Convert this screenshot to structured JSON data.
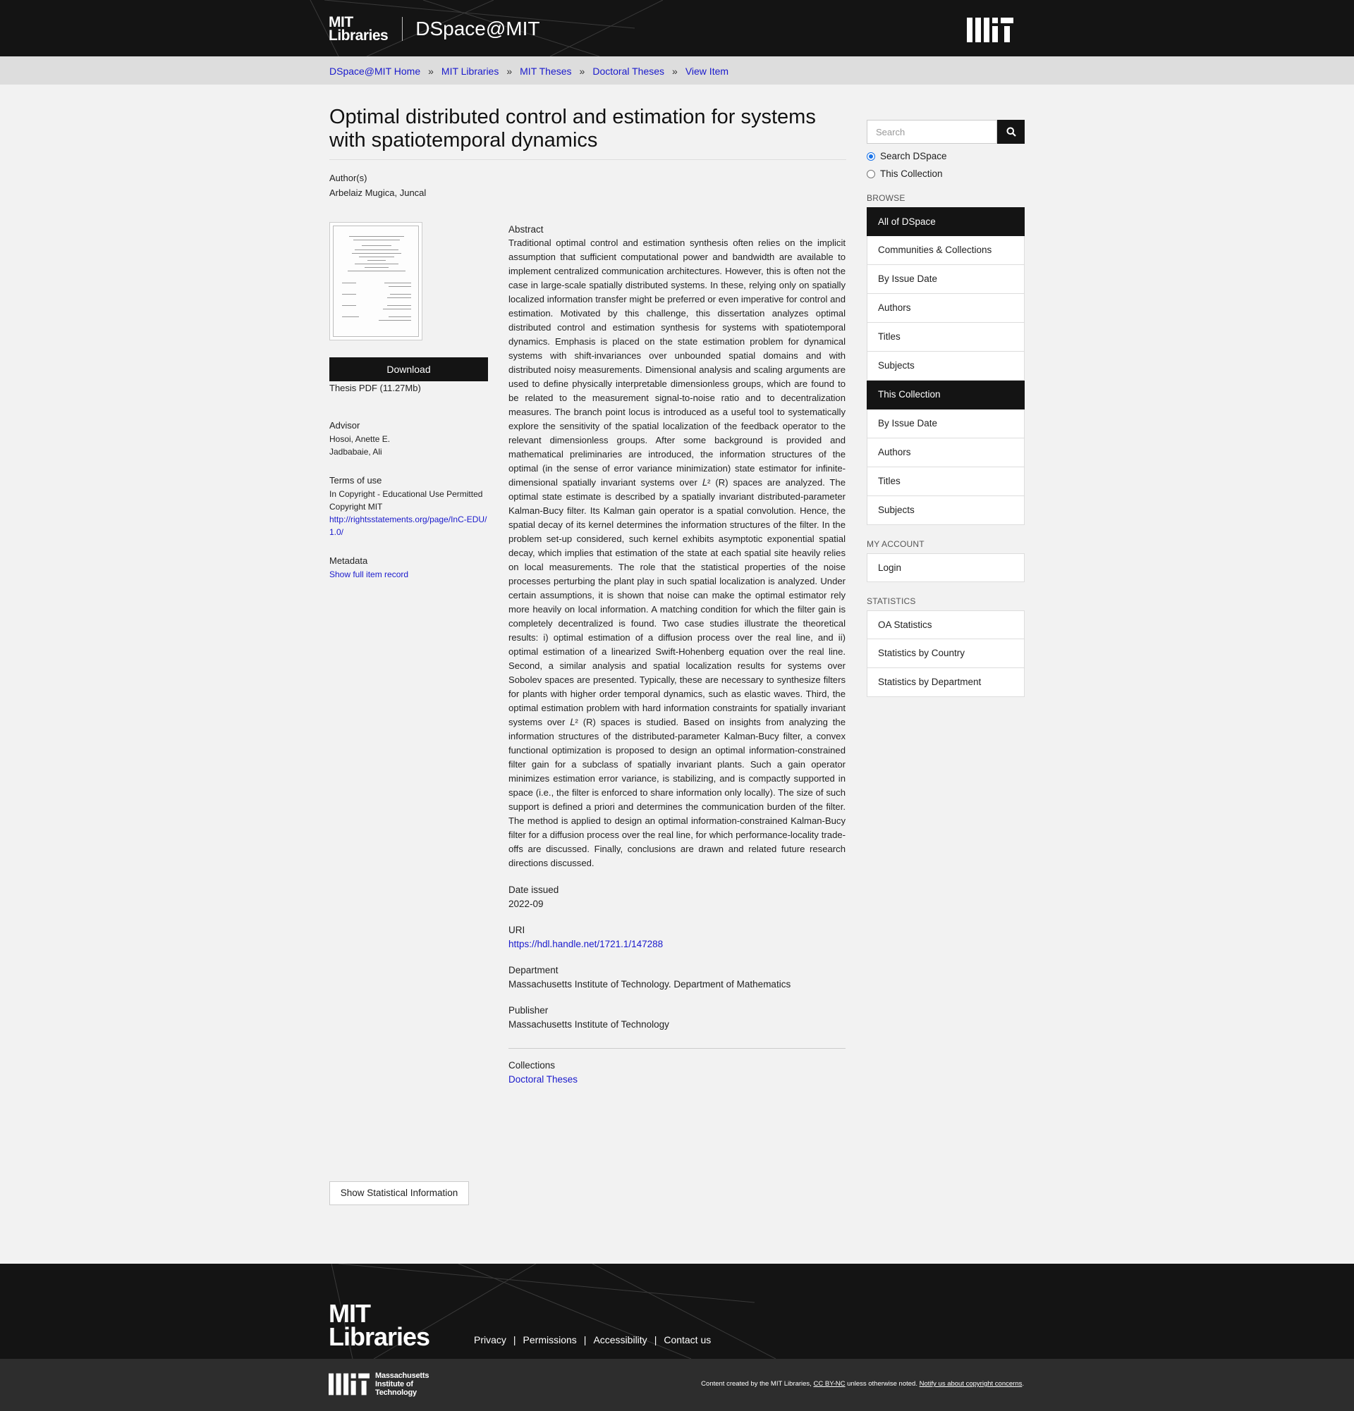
{
  "header": {
    "logo_line1": "MIT",
    "logo_line2": "Libraries",
    "site_name": "DSpace@MIT"
  },
  "breadcrumb": [
    "DSpace@MIT Home",
    "MIT Libraries",
    "MIT Theses",
    "Doctoral Theses",
    "View Item"
  ],
  "breadcrumb_sep": "»",
  "item": {
    "title": "Optimal distributed control and estimation for systems with spatiotemporal dynamics",
    "authors_label": "Author(s)",
    "authors_value": "Arbelaiz Mugica, Juncal",
    "download_label": "Download",
    "file_info": "Thesis PDF (11.27Mb)",
    "advisor_label": "Advisor",
    "advisors": [
      "Hosoi, Anette E.",
      "Jadbabaie, Ali"
    ],
    "terms_label": "Terms of use",
    "terms_text": "In Copyright - Educational Use Permitted Copyright MIT",
    "terms_link": "http://rightsstatements.org/page/InC-EDU/1.0/",
    "metadata_label": "Metadata",
    "metadata_link": "Show full item record",
    "abstract_label": "Abstract",
    "abstract_text": "Traditional optimal control and estimation synthesis often relies on the implicit assumption that sufficient computational power and bandwidth are available to implement centralized communication architectures. However, this is often not the case in large-scale spatially distributed systems. In these, relying only on spatially localized information transfer might be preferred or even imperative for control and estimation. Motivated by this challenge, this dissertation analyzes optimal distributed control and estimation synthesis for systems with spatiotemporal dynamics. Emphasis is placed on the state estimation problem for dynamical systems with shift-invariances over unbounded spatial domains and with distributed noisy measurements. Dimensional analysis and scaling arguments are used to define physically interpretable dimensionless groups, which are found to be related to the measurement signal-to-noise ratio and to decentralization measures. The branch point locus is introduced as a useful tool to systematically explore the sensitivity of the spatial localization of the feedback operator to the relevant dimensionless groups. After some background is provided and mathematical preliminaries are introduced, the information structures of the optimal (in the sense of error variance minimization) state estimator for infinite-dimensional spatially invariant systems over 𝐿² (R) spaces are analyzed. The optimal state estimate is described by a spatially invariant distributed-parameter Kalman-Bucy filter. Its Kalman gain operator is a spatial convolution. Hence, the spatial decay of its kernel determines the information structures of the filter. In the problem set-up considered, such kernel exhibits asymptotic exponential spatial decay, which implies that estimation of the state at each spatial site heavily relies on local measurements. The role that the statistical properties of the noise processes perturbing the plant play in such spatial localization is analyzed. Under certain assumptions, it is shown that noise can make the optimal estimator rely more heavily on local information. A matching condition for which the filter gain is completely decentralized is found. Two case studies illustrate the theoretical results: i) optimal estimation of a diffusion process over the real line, and ii) optimal estimation of a linearized Swift-Hohenberg equation over the real line. Second, a similar analysis and spatial localization results for systems over Sobolev spaces are presented. Typically, these are necessary to synthesize filters for plants with higher order temporal dynamics, such as elastic waves. Third, the optimal estimation problem with hard information constraints for spatially invariant systems over 𝐿² (R) spaces is studied. Based on insights from analyzing the information structures of the distributed-parameter Kalman-Bucy filter, a convex functional optimization is proposed to design an optimal information-constrained filter gain for a subclass of spatially invariant plants. Such a gain operator minimizes estimation error variance, is stabilizing, and is compactly supported in space (i.e., the filter is enforced to share information only locally). The size of such support is defined a priori and determines the communication burden of the filter. The method is applied to design an optimal information-constrained Kalman-Bucy filter for a diffusion process over the real line, for which performance-locality trade-offs are discussed. Finally, conclusions are drawn and related future research directions discussed.",
    "date_label": "Date issued",
    "date_value": "2022-09",
    "uri_label": "URI",
    "uri_value": "https://hdl.handle.net/1721.1/147288",
    "department_label": "Department",
    "department_value": "Massachusetts Institute of Technology. Department of Mathematics",
    "publisher_label": "Publisher",
    "publisher_value": "Massachusetts Institute of Technology",
    "collections_label": "Collections",
    "collections_value": "Doctoral Theses",
    "stat_button": "Show Statistical Information"
  },
  "sidebar": {
    "search_placeholder": "Search",
    "radio_search_dspace": "Search DSpace",
    "radio_this_collection": "This Collection",
    "browse_heading": "BROWSE",
    "browse_all_heading": "All of DSpace",
    "browse_all_items": [
      "Communities & Collections",
      "By Issue Date",
      "Authors",
      "Titles",
      "Subjects"
    ],
    "browse_coll_heading": "This Collection",
    "browse_coll_items": [
      "By Issue Date",
      "Authors",
      "Titles",
      "Subjects"
    ],
    "account_heading": "MY ACCOUNT",
    "account_items": [
      "Login"
    ],
    "stats_heading": "STATISTICS",
    "stats_items": [
      "OA Statistics",
      "Statistics by Country",
      "Statistics by Department"
    ]
  },
  "footer": {
    "logo_line1": "MIT",
    "logo_line2": "Libraries",
    "links": [
      "Privacy",
      "Permissions",
      "Accessibility",
      "Contact us"
    ],
    "link_sep": "|",
    "inst_line1": "Massachusetts",
    "inst_line2": "Institute of",
    "inst_line3": "Technology",
    "notice_prefix": "Content created by the MIT Libraries, ",
    "notice_license": "CC BY-NC",
    "notice_mid": " unless otherwise noted. ",
    "notice_link": "Notify us about copyright concerns",
    "notice_end": "."
  },
  "colors": {
    "header_bg": "#141414",
    "link": "#1a1acc",
    "crumb_bg": "#dddddd",
    "page_bg": "#f2f2f2"
  }
}
